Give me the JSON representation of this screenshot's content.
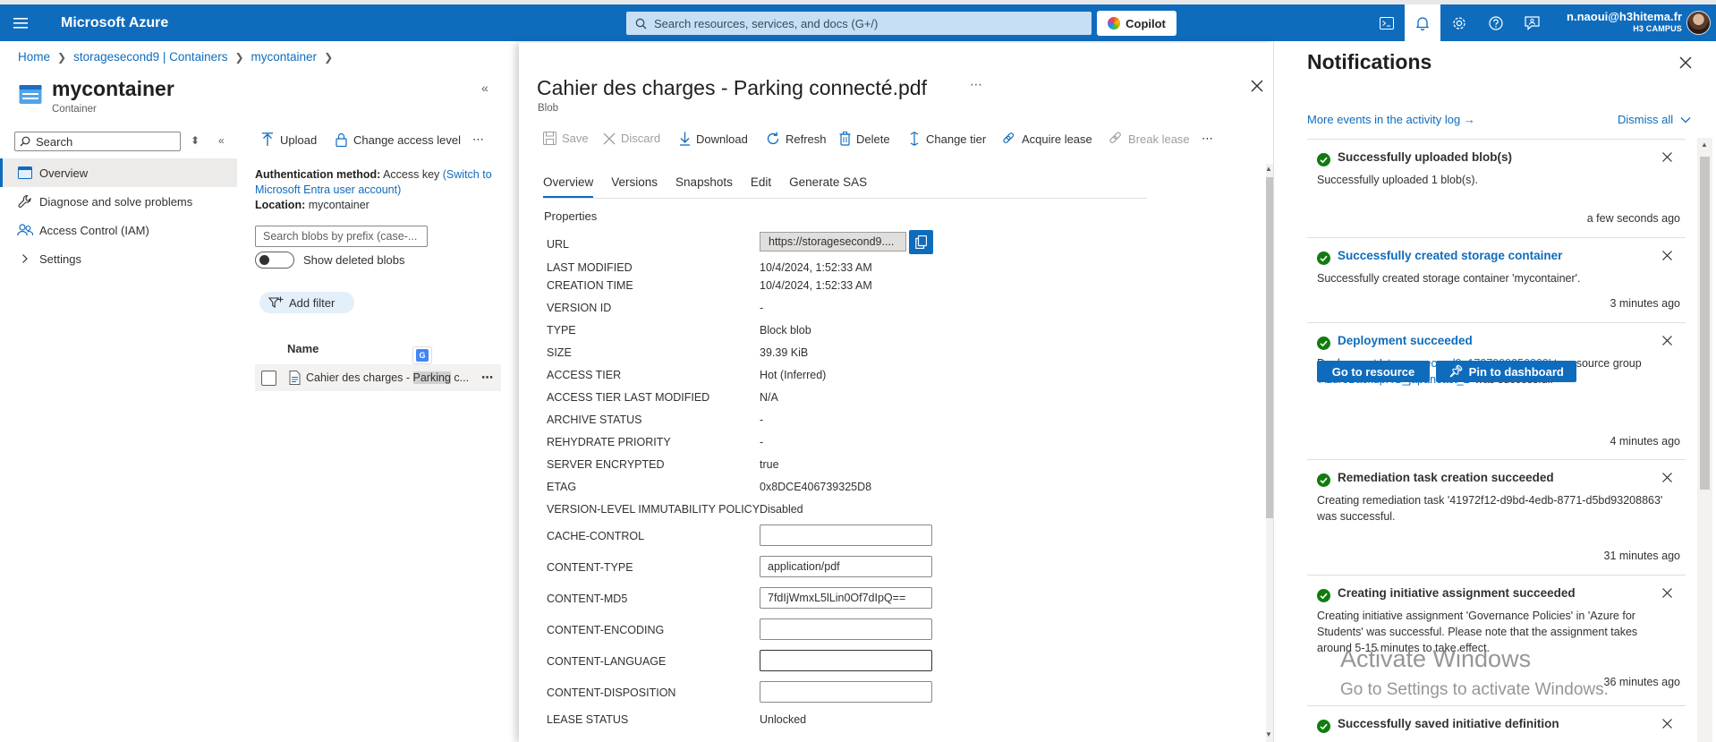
{
  "topbar": {
    "brand": "Microsoft Azure",
    "search_placeholder": "Search resources, services, and docs (G+/)",
    "copilot": "Copilot",
    "account_email": "n.naoui@h3hitema.fr",
    "account_org": "H3 CAMPUS",
    "accent": "#0f6cbd"
  },
  "breadcrumb": [
    "Home",
    "storagesecond9 | Containers",
    "mycontainer"
  ],
  "resource": {
    "title": "mycontainer",
    "subtitle": "Container",
    "search_placeholder": "Search",
    "menu": [
      {
        "label": "Overview",
        "icon": "overview-icon",
        "selected": true
      },
      {
        "label": "Diagnose and solve problems",
        "icon": "wrench-icon"
      },
      {
        "label": "Access Control (IAM)",
        "icon": "people-icon"
      },
      {
        "label": "Settings",
        "icon": "chevron-right-icon"
      }
    ]
  },
  "blobs": {
    "toolbar": {
      "upload": "Upload",
      "change_access": "Change access level"
    },
    "auth_label": "Authentication method:",
    "auth_value": "Access key",
    "auth_link": "(Switch to Microsoft Entra user account)",
    "location_label": "Location:",
    "location_value": "mycontainer",
    "prefix_placeholder": "Search blobs by prefix (case-...",
    "show_deleted": "Show deleted blobs",
    "add_filter": "Add filter",
    "column_name": "Name",
    "rows": [
      {
        "pre": "Cahier des charges - ",
        "highlight": "Parking",
        "post": " c..."
      }
    ]
  },
  "detail": {
    "title": "Cahier des charges - Parking connecté.pdf",
    "subtitle": "Blob",
    "toolbar": {
      "save": "Save",
      "discard": "Discard",
      "download": "Download",
      "refresh": "Refresh",
      "delete": "Delete",
      "change_tier": "Change tier",
      "acquire_lease": "Acquire lease",
      "break_lease": "Break lease"
    },
    "tabs": [
      "Overview",
      "Versions",
      "Snapshots",
      "Edit",
      "Generate SAS"
    ],
    "section": "Properties",
    "url_label": "URL",
    "url_value": "https://storagesecond9....",
    "properties": [
      {
        "label": "LAST MODIFIED",
        "value": "10/4/2024, 1:52:33 AM"
      },
      {
        "label": "CREATION TIME",
        "value": "10/4/2024, 1:52:33 AM"
      },
      {
        "label": "VERSION ID",
        "value": "-"
      },
      {
        "label": "TYPE",
        "value": "Block blob"
      },
      {
        "label": "SIZE",
        "value": "39.39 KiB"
      },
      {
        "label": "ACCESS TIER",
        "value": "Hot (Inferred)"
      },
      {
        "label": "ACCESS TIER LAST MODIFIED",
        "value": "N/A"
      },
      {
        "label": "ARCHIVE STATUS",
        "value": "-"
      },
      {
        "label": "REHYDRATE PRIORITY",
        "value": "-"
      },
      {
        "label": "SERVER ENCRYPTED",
        "value": "true"
      },
      {
        "label": "ETAG",
        "value": "0x8DCE406739325D8"
      },
      {
        "label": "VERSION-LEVEL IMMUTABILITY POLICY",
        "value": "Disabled"
      }
    ],
    "editable": [
      {
        "label": "CACHE-CONTROL",
        "value": ""
      },
      {
        "label": "CONTENT-TYPE",
        "value": "application/pdf"
      },
      {
        "label": "CONTENT-MD5",
        "value": "7fdIjWmxL5lLin0Of7dIpQ=="
      },
      {
        "label": "CONTENT-ENCODING",
        "value": ""
      },
      {
        "label": "CONTENT-LANGUAGE",
        "value": ""
      },
      {
        "label": "CONTENT-DISPOSITION",
        "value": ""
      }
    ],
    "lease_label": "LEASE STATUS",
    "lease_value": "Unlocked"
  },
  "notifications": {
    "title": "Notifications",
    "activity_link": "More events in the activity log →",
    "dismiss_all": "Dismiss all",
    "success_color": "#107c10",
    "items": [
      {
        "title": "Successfully uploaded blob(s)",
        "body": "Successfully uploaded 1 blob(s).",
        "time": "a few seconds ago"
      },
      {
        "title": "Successfully created storage container",
        "body": "Successfully created storage container 'mycontainer'.",
        "time": "3 minutes ago"
      },
      {
        "title": "Deployment succeeded",
        "body_pre": "Deployment '",
        "body_link1": "storagesecond9_1727999256809",
        "body_mid": "' to resource group '",
        "body_link2": "AzureBackupRG_japaneast_1",
        "body_post": "' was successful.",
        "btn_go": "Go to resource",
        "btn_pin": "Pin to dashboard",
        "time": "4 minutes ago"
      },
      {
        "title": "Remediation task creation succeeded",
        "body": "Creating remediation task '41972f12-d9bd-4edb-8771-d5bd93208863' was successful.",
        "time": "31 minutes ago"
      },
      {
        "title": "Creating initiative assignment succeeded",
        "body": "Creating initiative assignment 'Governance Policies' in 'Azure for Students' was successful. Please note that the assignment takes around 5-15 minutes to take effect.",
        "time": "36 minutes ago"
      },
      {
        "title": "Successfully saved initiative definition"
      }
    ]
  },
  "watermark": {
    "line1": "Activate Windows",
    "line2": "Go to Settings to activate Windows."
  }
}
